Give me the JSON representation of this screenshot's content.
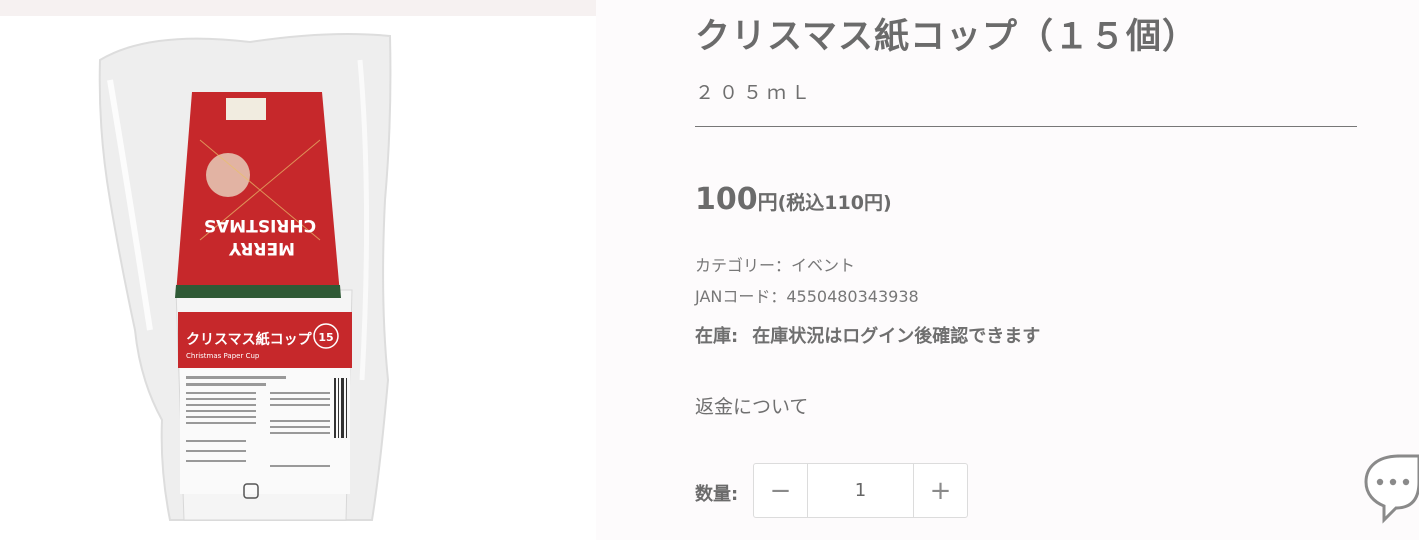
{
  "product": {
    "title": "クリスマス紙コップ（１５個）",
    "subtitle": "２０５ｍＬ",
    "price": {
      "main": "100",
      "yen": "円",
      "tax": "(税込110円)"
    },
    "category": "カテゴリー：イベント",
    "jan": "JANコード：4550480343938",
    "stock_label": "在庫:",
    "stock_value": "在庫状況はログイン後確認できます",
    "refund_link": "返金について"
  },
  "quantity": {
    "label": "数量:",
    "value": "1",
    "minus": "−",
    "plus": "+"
  },
  "package": {
    "label_title": "クリスマス紙コップ",
    "label_sub": "Christmas Paper Cup",
    "count_badge": "15",
    "cup_text_1": "MERRY",
    "cup_text_2": "CHRISTMAS"
  },
  "colors": {
    "accent_red": "#c6282b",
    "text": "#6b6b6b"
  },
  "icons": {
    "chat": "chat-bubble-icon"
  }
}
